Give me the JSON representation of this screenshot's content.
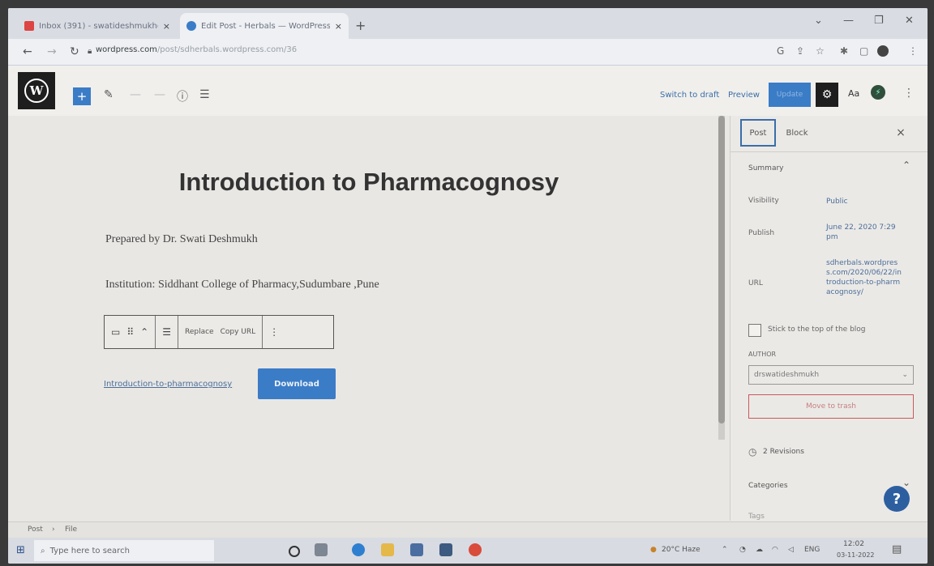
{
  "browser": {
    "tabs": [
      {
        "title": "Inbox (391) - swatideshmukh@...",
        "close": "×"
      },
      {
        "title": "Edit Post - Herbals — WordPress",
        "close": "×"
      }
    ],
    "new_tab": "+",
    "url_host": "wordpress.com",
    "url_rest": "/post/sdherbals.wordpress.com/36",
    "window_controls": {
      "chevron": "⌄",
      "minimize": "—",
      "restore": "❐",
      "close": "✕"
    }
  },
  "wp_toolbar": {
    "switch_to_draft": "Switch to draft",
    "preview": "Preview",
    "update": "Update",
    "aa": "Aa"
  },
  "editor": {
    "title": "Introduction to Pharmacognosy",
    "prepared_by": "Prepared by Dr. Swati Deshmukh",
    "institution": "Institution: Siddhant College of Pharmacy,Sudumbare ,Pune",
    "block_toolbar": {
      "replace": "Replace",
      "copy_url": "Copy URL"
    },
    "file_link": "Introduction-to-pharmacognosy",
    "download": "Download"
  },
  "sidebar": {
    "tab_post": "Post",
    "tab_block": "Block",
    "close": "×",
    "summary": "Summary",
    "visibility_label": "Visibility",
    "visibility_value": "Public",
    "publish_label": "Publish",
    "publish_value": "June 22, 2020 7:29 pm",
    "url_label": "URL",
    "url_value": "sdherbals.wordpress.com/2020/06/22/introduction-to-pharmacognosy/",
    "sticky": "Stick to the top of the blog",
    "author_label": "AUTHOR",
    "author_value": "drswatideshmukh",
    "move_to_trash": "Move to trash",
    "revisions": "2 Revisions",
    "categories": "Categories",
    "tags": "Tags"
  },
  "breadcrumb": {
    "post": "Post",
    "sep": "›",
    "file": "File"
  },
  "taskbar": {
    "search_placeholder": "Type here to search",
    "weather": "20°C Haze",
    "lang": "ENG",
    "time": "12:02",
    "date": "03-11-2022"
  },
  "help": "?"
}
